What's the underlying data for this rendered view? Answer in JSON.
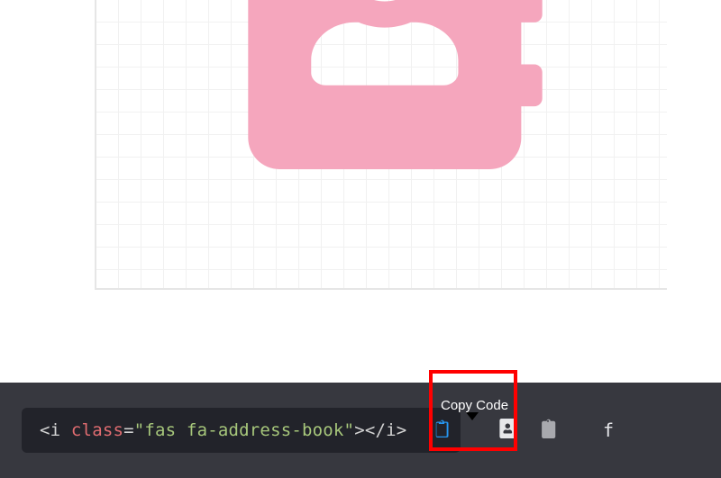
{
  "preview": {
    "icon_name": "address-book"
  },
  "code": {
    "open_bracket": "<",
    "tag_name": "i",
    "attr_name": "class",
    "eq": "=",
    "quote": "\"",
    "class_value": "fas fa-address-book",
    "close_bracket": ">",
    "end_open": "</",
    "end_tag": "i",
    "end_close": ">"
  },
  "tooltip": {
    "label": "Copy Code"
  },
  "trailing_letter": "f"
}
